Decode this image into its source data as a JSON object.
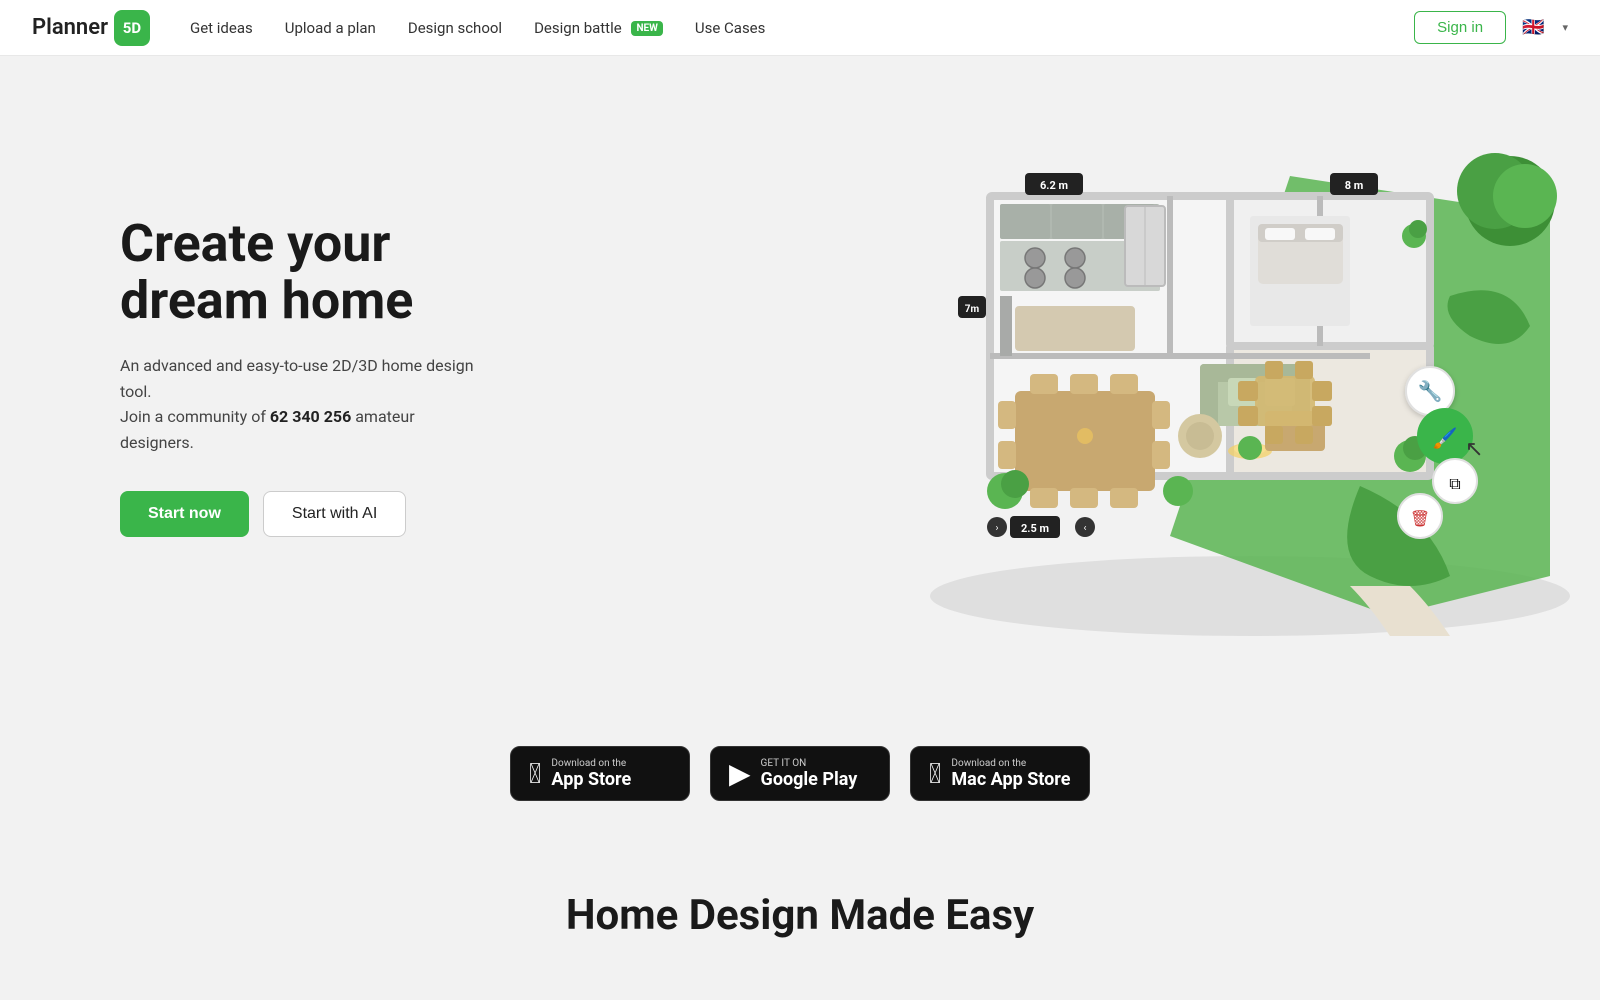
{
  "nav": {
    "logo_text": "Planner",
    "logo_5d": "5D",
    "get_ideas": "Get ideas",
    "upload_plan": "Upload a plan",
    "design_school": "Design school",
    "design_battle": "Design battle",
    "design_battle_badge": "NEW",
    "use_cases": "Use Cases",
    "sign_in": "Sign in",
    "lang_flag": "🇬🇧"
  },
  "hero": {
    "title": "Create your dream home",
    "desc_start": "An advanced and easy-to-use 2D/3D home design tool.",
    "desc_community": "Join a community of ",
    "user_count": "62 340 256",
    "desc_end": " amateur designers.",
    "btn_start_now": "Start now",
    "btn_start_ai": "Start with AI"
  },
  "measurements": {
    "top_left": "6.2 m",
    "top_right": "8 m",
    "left_side": "7 m",
    "bottom": "2.5 m"
  },
  "store": {
    "app_store_label": "Download on the",
    "app_store_name": "App Store",
    "google_play_label": "GET IT ON",
    "google_play_name": "Google Play",
    "mac_store_label": "Download on the",
    "mac_store_name": "Mac App Store"
  },
  "bottom": {
    "title": "Home Design Made Easy"
  }
}
